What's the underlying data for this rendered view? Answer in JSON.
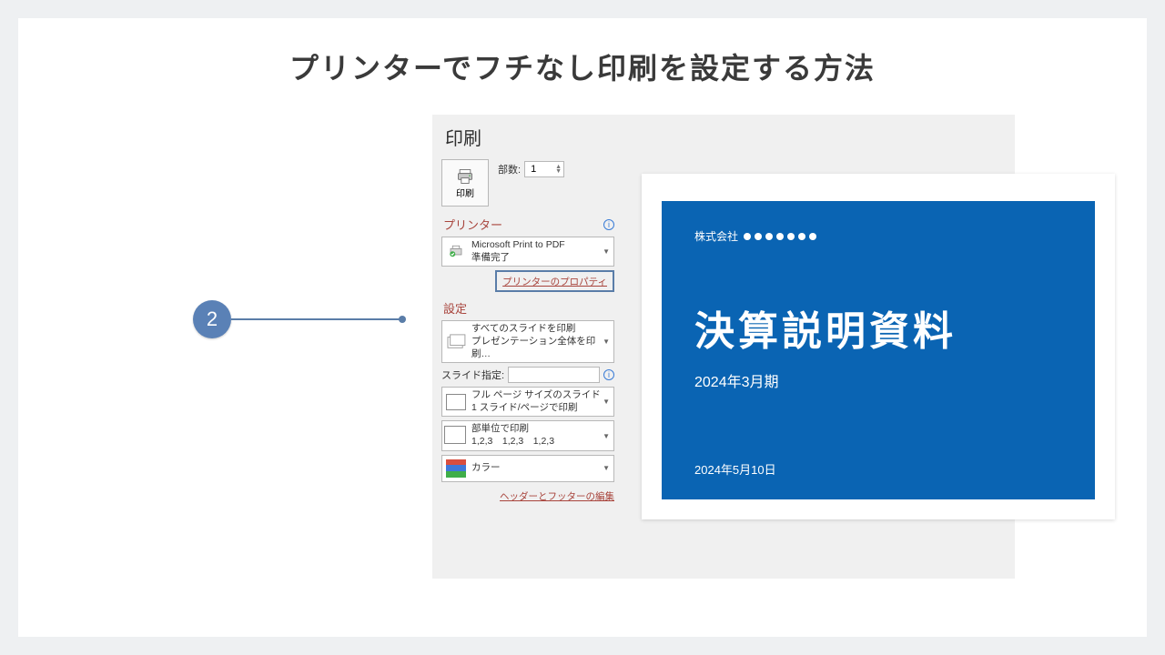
{
  "page_title": "プリンターでフチなし印刷を設定する方法",
  "callout_number": "2",
  "print": {
    "heading": "印刷",
    "button_label": "印刷",
    "copies_label": "部数:",
    "copies_value": "1",
    "printer_section": "プリンター",
    "printer_name": "Microsoft Print to PDF",
    "printer_status": "準備完了",
    "printer_properties_link": "プリンターのプロパティ",
    "settings_section": "設定",
    "slides_all_line1": "すべてのスライドを印刷",
    "slides_all_line2": "プレゼンテーション全体を印刷…",
    "slide_spec_label": "スライド指定:",
    "layout_line1": "フル ページ サイズのスライド",
    "layout_line2": "1 スライド/ページで印刷",
    "collate_line1": "部単位で印刷",
    "collate_line2": "1,2,3　1,2,3　1,2,3",
    "color_label": "カラー",
    "header_footer_link": "ヘッダーとフッターの編集"
  },
  "slide": {
    "company_prefix": "株式会社",
    "title": "決算説明資料",
    "subtitle": "2024年3月期",
    "date": "2024年5月10日"
  }
}
